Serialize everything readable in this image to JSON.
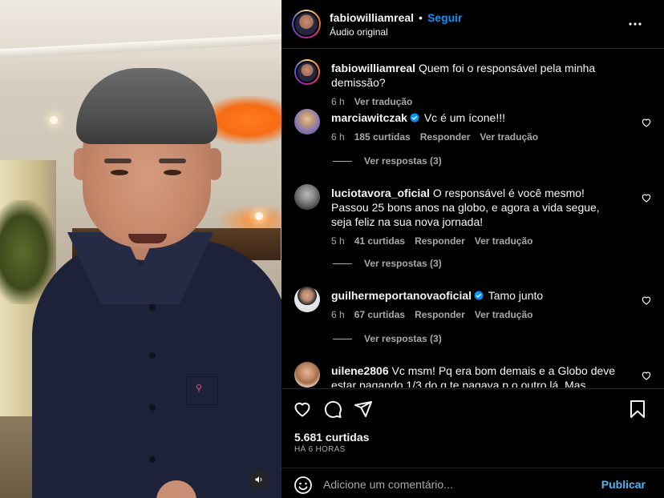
{
  "header": {
    "username": "fabiowilliamreal",
    "separator": "•",
    "follow_label": "Seguir",
    "audio_label": "Áudio original"
  },
  "caption": {
    "username": "fabiowilliamreal",
    "text": "Quem foi o responsável pela minha demissão?",
    "time": "6 h",
    "translate_label": "Ver tradução"
  },
  "comments": [
    {
      "username": "marciawitczak",
      "verified": true,
      "text": "Vc é um ícone!!!",
      "time": "6 h",
      "likes": "185 curtidas",
      "reply_label": "Responder",
      "translate_label": "Ver tradução",
      "replies_label": "Ver respostas (3)"
    },
    {
      "username": "luciotavora_oficial",
      "verified": false,
      "text": "O responsável é você mesmo! Passou 25 bons anos na globo, e agora a vida segue, seja feliz na sua nova jornada!",
      "time": "5 h",
      "likes": "41 curtidas",
      "reply_label": "Responder",
      "translate_label": "Ver tradução",
      "replies_label": "Ver respostas (3)"
    },
    {
      "username": "guilhermeportanovaoficial",
      "verified": true,
      "text": "Tamo junto",
      "time": "6 h",
      "likes": "67 curtidas",
      "reply_label": "Responder",
      "translate_label": "Ver tradução",
      "replies_label": "Ver respostas (3)"
    },
    {
      "username": "uilene2806",
      "verified": false,
      "text": "Vc msm! Pq era bom demais e a Globo deve estar pagando 1/3 do q te pagava p o outro lá. Mas certeza q foi um",
      "time": "",
      "likes": "",
      "reply_label": "",
      "translate_label": "",
      "replies_label": ""
    }
  ],
  "footer": {
    "likes_count": "5.681 curtidas",
    "posted_ago": "HÁ 6 HORAS",
    "comment_placeholder": "Adicione um comentário...",
    "publish_label": "Publicar"
  },
  "icons": {
    "header_more": "more-horizontal-icon",
    "like": "heart-icon",
    "comment": "comment-icon",
    "share": "send-icon",
    "save": "bookmark-icon",
    "emoji": "emoji-icon",
    "mute": "volume-icon",
    "verified": "verified-badge-icon"
  },
  "colors": {
    "background": "#000000",
    "text_primary": "#f5f5f5",
    "text_secondary": "#a8a8a8",
    "link_blue": "#0095f6",
    "publish_blue": "#4cb5f9",
    "divider": "#262626"
  }
}
